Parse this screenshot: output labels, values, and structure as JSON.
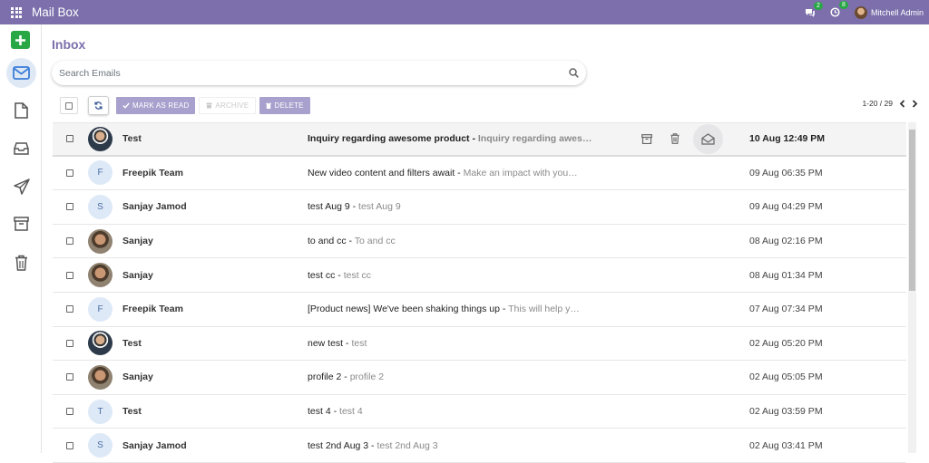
{
  "navbar": {
    "app_title": "Mail Box",
    "messages_badge": "2",
    "activities_badge": "8",
    "user_name": "Mitchell Admin"
  },
  "sidebar": {
    "items": [
      {
        "name": "compose",
        "icon": "plus-icon"
      },
      {
        "name": "inbox",
        "icon": "envelope-icon",
        "active": true
      },
      {
        "name": "drafts",
        "icon": "file-icon"
      },
      {
        "name": "all-mail",
        "icon": "inbox-tray-icon"
      },
      {
        "name": "sent",
        "icon": "paper-plane-icon"
      },
      {
        "name": "archive",
        "icon": "archive-box-icon"
      },
      {
        "name": "trash",
        "icon": "trash-icon"
      }
    ]
  },
  "main": {
    "title": "Inbox",
    "search_placeholder": "Search Emails",
    "toolbar": {
      "mark_read_label": "MARK AS READ",
      "archive_label": "ARCHIVE",
      "delete_label": "DELETE"
    },
    "pager": "1-20 / 29"
  },
  "colors": {
    "brand": "#7c6fab",
    "button": "#a9a1cd",
    "compose": "#28a745",
    "badge": "#28a745"
  },
  "emails": [
    {
      "sender": "Test",
      "avatar": "photo",
      "subject": "Inquiry regarding awesome product",
      "snippet": "Inquiry regarding awes…",
      "date": "10 Aug 12:49 PM",
      "hovered": true
    },
    {
      "sender": "Freepik Team",
      "avatar": "F",
      "subject": "New video content and filters await",
      "snippet": "Make an impact with you…",
      "date": "09 Aug 06:35 PM"
    },
    {
      "sender": "Sanjay Jamod",
      "avatar": "S",
      "subject": "test Aug 9",
      "snippet": "test Aug 9",
      "date": "09 Aug 04:29 PM"
    },
    {
      "sender": "Sanjay",
      "avatar": "photo",
      "subject": "to and cc",
      "snippet": "To and cc",
      "date": "08 Aug 02:16 PM"
    },
    {
      "sender": "Sanjay",
      "avatar": "photo",
      "subject": "test cc",
      "snippet": "test cc",
      "date": "08 Aug 01:34 PM"
    },
    {
      "sender": "Freepik Team",
      "avatar": "F",
      "subject": "[Product news] We've been shaking things up",
      "snippet": "This will help y…",
      "date": "07 Aug 07:34 PM"
    },
    {
      "sender": "Test",
      "avatar": "photo",
      "subject": "new test",
      "snippet": "test",
      "date": "02 Aug 05:20 PM"
    },
    {
      "sender": "Sanjay",
      "avatar": "photo",
      "subject": "profile 2",
      "snippet": "profile 2",
      "date": "02 Aug 05:05 PM"
    },
    {
      "sender": "Test",
      "avatar": "T",
      "subject": "test 4",
      "snippet": "test 4",
      "date": "02 Aug 03:59 PM"
    },
    {
      "sender": "Sanjay Jamod",
      "avatar": "S",
      "subject": "test 2nd Aug 3",
      "snippet": "test 2nd Aug 3",
      "date": "02 Aug 03:41 PM"
    }
  ]
}
